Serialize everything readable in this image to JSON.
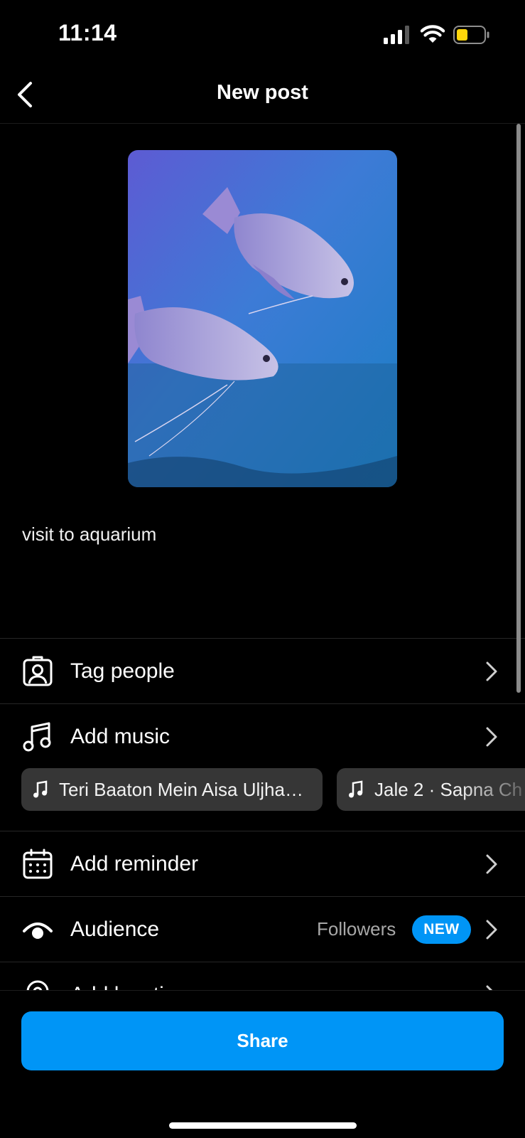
{
  "status_bar": {
    "time": "11:14"
  },
  "header": {
    "title": "New post"
  },
  "caption": {
    "text": "visit to aquarium"
  },
  "rows": {
    "tag_people": {
      "label": "Tag people"
    },
    "add_music": {
      "label": "Add music",
      "suggestions": [
        {
          "label": "Teri Baaton Mein Aisa Uljha…"
        },
        {
          "label": "Jale 2 · Sapna Ch"
        }
      ]
    },
    "add_reminder": {
      "label": "Add reminder"
    },
    "audience": {
      "label": "Audience",
      "value": "Followers",
      "badge": "NEW"
    },
    "add_location": {
      "label": "Add location"
    }
  },
  "share": {
    "label": "Share"
  },
  "colors": {
    "accent": "#0095f6",
    "chip_bg": "#363636",
    "divider": "#262626"
  }
}
